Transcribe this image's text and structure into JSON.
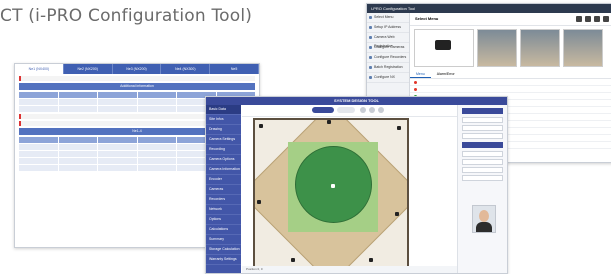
{
  "heading": {
    "text": "CT (i-PRO Configuration Tool)"
  },
  "window_right": {
    "title": "i-PRO Configuration Tool",
    "header": "Select Menu",
    "sidebar_items": [
      "Select Menu",
      "Setup IP Address",
      "Camera Web Registration",
      "Configure Cameras",
      "Configure Recorders",
      "Batch Registration",
      "Configure NX"
    ],
    "thumb_label": "Recorder / Encoder",
    "tabs": [
      "Menu",
      "Alarm/Error"
    ]
  },
  "window_left": {
    "tabs": [
      "Ne1 (NX400)",
      "Ne2 (NX200)",
      "Ne3 (NX200)",
      "Ne4 (NX300)",
      "Ne5"
    ],
    "section_title": "Additional information",
    "section_title_2": "Ne1-4"
  },
  "window_center": {
    "title": "SYSTEM DESIGN TOOL",
    "nav_items": [
      "Basic Data",
      "Site Infos",
      "Drawing",
      "Camera Settings",
      "Recording",
      "Camera Options",
      "Camera Information",
      "Encoder",
      "Cameras",
      "Recorders",
      "Network",
      "Options",
      "Calculations",
      "Summary",
      "Storage Calculation",
      "Warranty Settings"
    ],
    "nav_selected_index": 0,
    "status": "Position 0, 0"
  }
}
